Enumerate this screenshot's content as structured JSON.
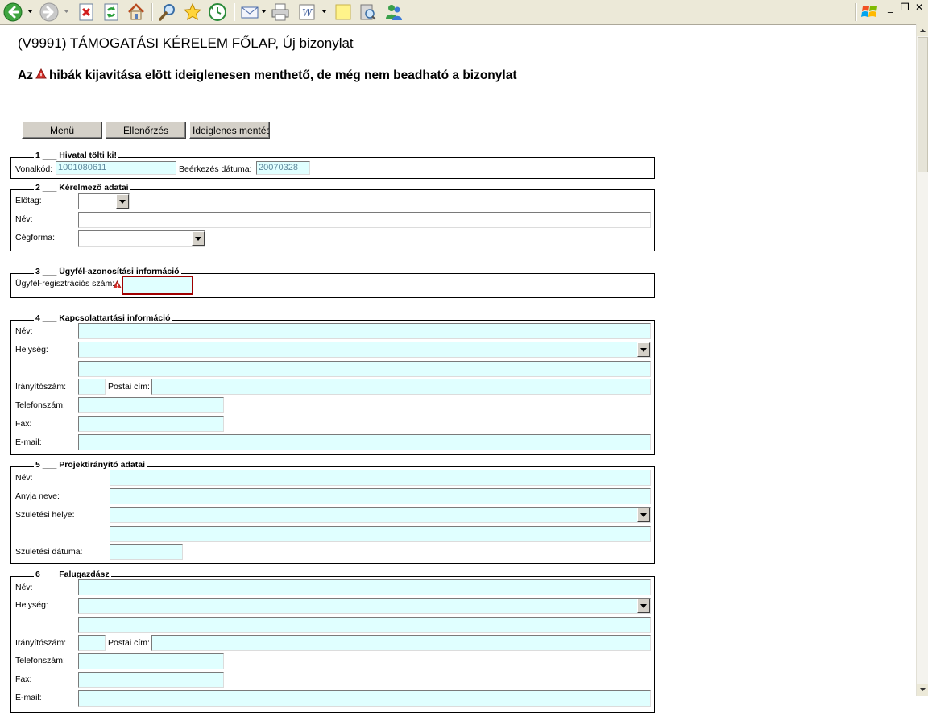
{
  "toolbar": {
    "icons": [
      "back-icon",
      "forward-icon",
      "stop-icon",
      "refresh-icon",
      "home-icon",
      "search-icon",
      "favorites-icon",
      "history-icon",
      "mail-icon",
      "print-icon",
      "edit-icon",
      "notes-icon",
      "research-icon",
      "messenger-icon"
    ]
  },
  "window": {
    "minimize": "_",
    "restore": "❐",
    "close": "✕"
  },
  "page": {
    "title": "(V9991) TÁMOGATÁSI KÉRELEM FŐLAP, Új bizonylat",
    "warning_before": "Az",
    "warning_after": "hibák kijavitása elött ideiglenesen menthető, de még nem beadható a bizonylat"
  },
  "buttons": {
    "menu": "Menü",
    "check": "Ellenőrzés",
    "save_temp": "Ideiglenes mentés"
  },
  "sections": {
    "s1": {
      "number": "1",
      "title": "Hivatal tölti ki!",
      "barcode_label": "Vonalkód:",
      "barcode_value": "1001080611",
      "arrival_label": "Beérkezés dátuma:",
      "arrival_value": "20070328"
    },
    "s2": {
      "number": "2",
      "title": "Kérelmező adatai",
      "prefix_label": "Előtag:",
      "name_label": "Név:",
      "company_form_label": "Cégforma:"
    },
    "s3": {
      "number": "3",
      "title": "Ügyfél-azonosítási információ",
      "reg_label": "Ügyfél-regisztrációs szám:"
    },
    "s4": {
      "number": "4",
      "title": "Kapcsolattartási információ",
      "name_label": "Név:",
      "city_label": "Helység:",
      "zip_label": "Irányítószám:",
      "postal_label": "Postai cím:",
      "phone_label": "Telefonszám:",
      "fax_label": "Fax:",
      "email_label": "E-mail:"
    },
    "s5": {
      "number": "5",
      "title": "Projektirányító adatai",
      "name_label": "Név:",
      "mother_label": "Anyja neve:",
      "birthplace_label": "Születési helye:",
      "birthdate_label": "Születési dátuma:"
    },
    "s6": {
      "number": "6",
      "title": "Falugazdász",
      "name_label": "Név:",
      "city_label": "Helység:",
      "zip_label": "Irányítószám:",
      "postal_label": "Postai cím:",
      "phone_label": "Telefonszám:",
      "fax_label": "Fax:",
      "email_label": "E-mail:"
    }
  }
}
